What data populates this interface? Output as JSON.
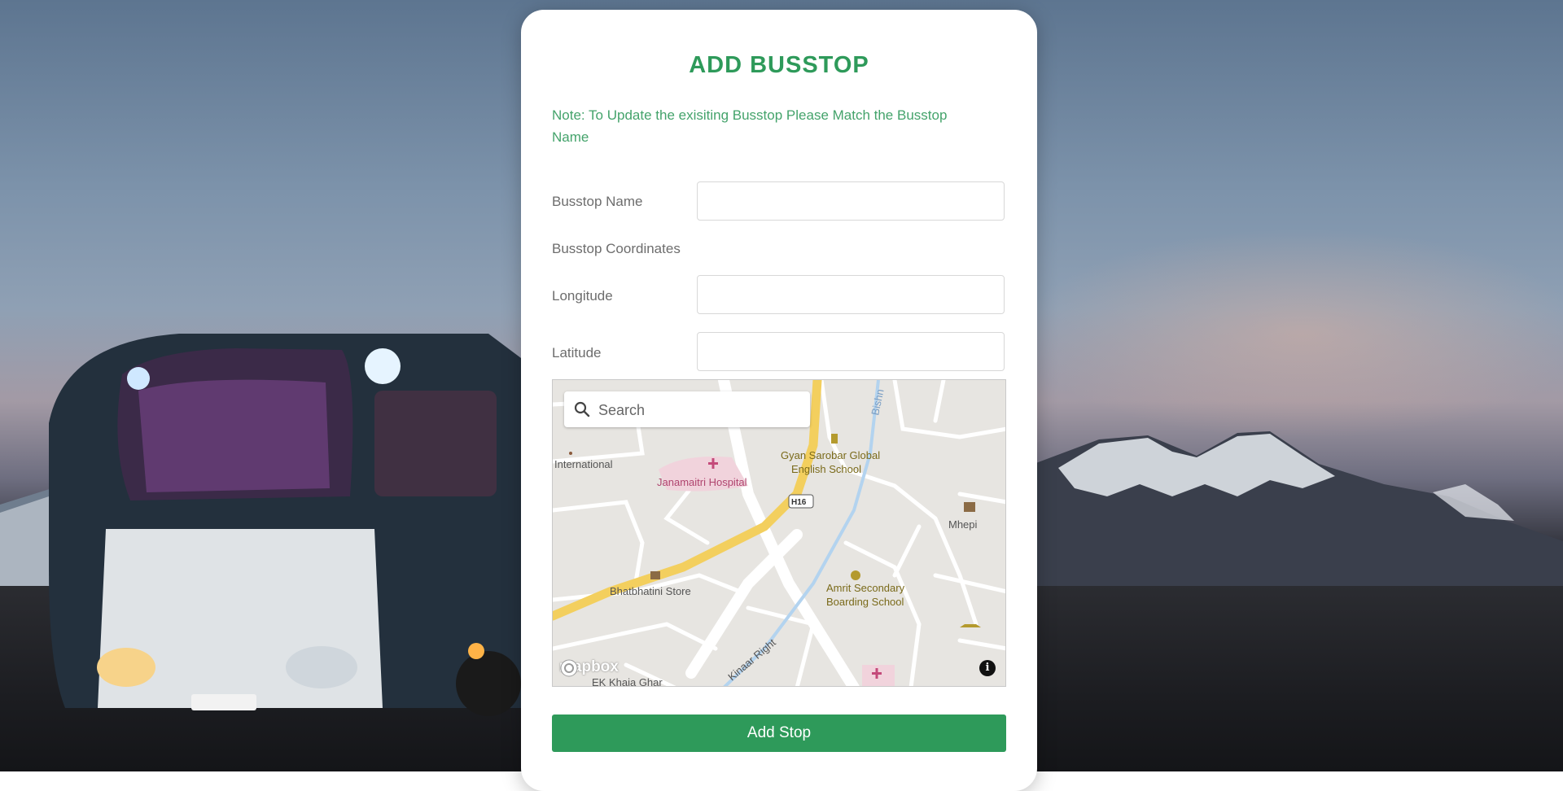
{
  "form": {
    "title": "ADD BUSSTOP",
    "note": "Note: To Update the exisiting Busstop Please Match the Busstop Name",
    "busstop_name_label": "Busstop Name",
    "busstop_name_value": "",
    "coordinates_label": "Busstop Coordinates",
    "longitude_label": "Longitude",
    "longitude_value": "",
    "latitude_label": "Latitude",
    "latitude_value": "",
    "submit_label": "Add Stop"
  },
  "map": {
    "search_placeholder": "Search",
    "attribution_logo": "mapbox",
    "info_icon": "i",
    "labels": {
      "international": "International",
      "hospital": "Janamaitri Hospital",
      "school1_line1": "Gyan Sarobar Global",
      "school1_line2": "English School",
      "route": "H16",
      "mhepi": "Mhepi",
      "store": "Bhatbhatini Store",
      "school2_line1": "Amrit Secondary",
      "school2_line2": "Boarding School",
      "road": "Kinaar Right",
      "bottom_place": "EK Khaja Ghar",
      "top_place": "Bishn"
    }
  },
  "colors": {
    "accent": "#2e9a5a",
    "note_text": "#44a36b",
    "label_text": "#6d6d6d"
  }
}
